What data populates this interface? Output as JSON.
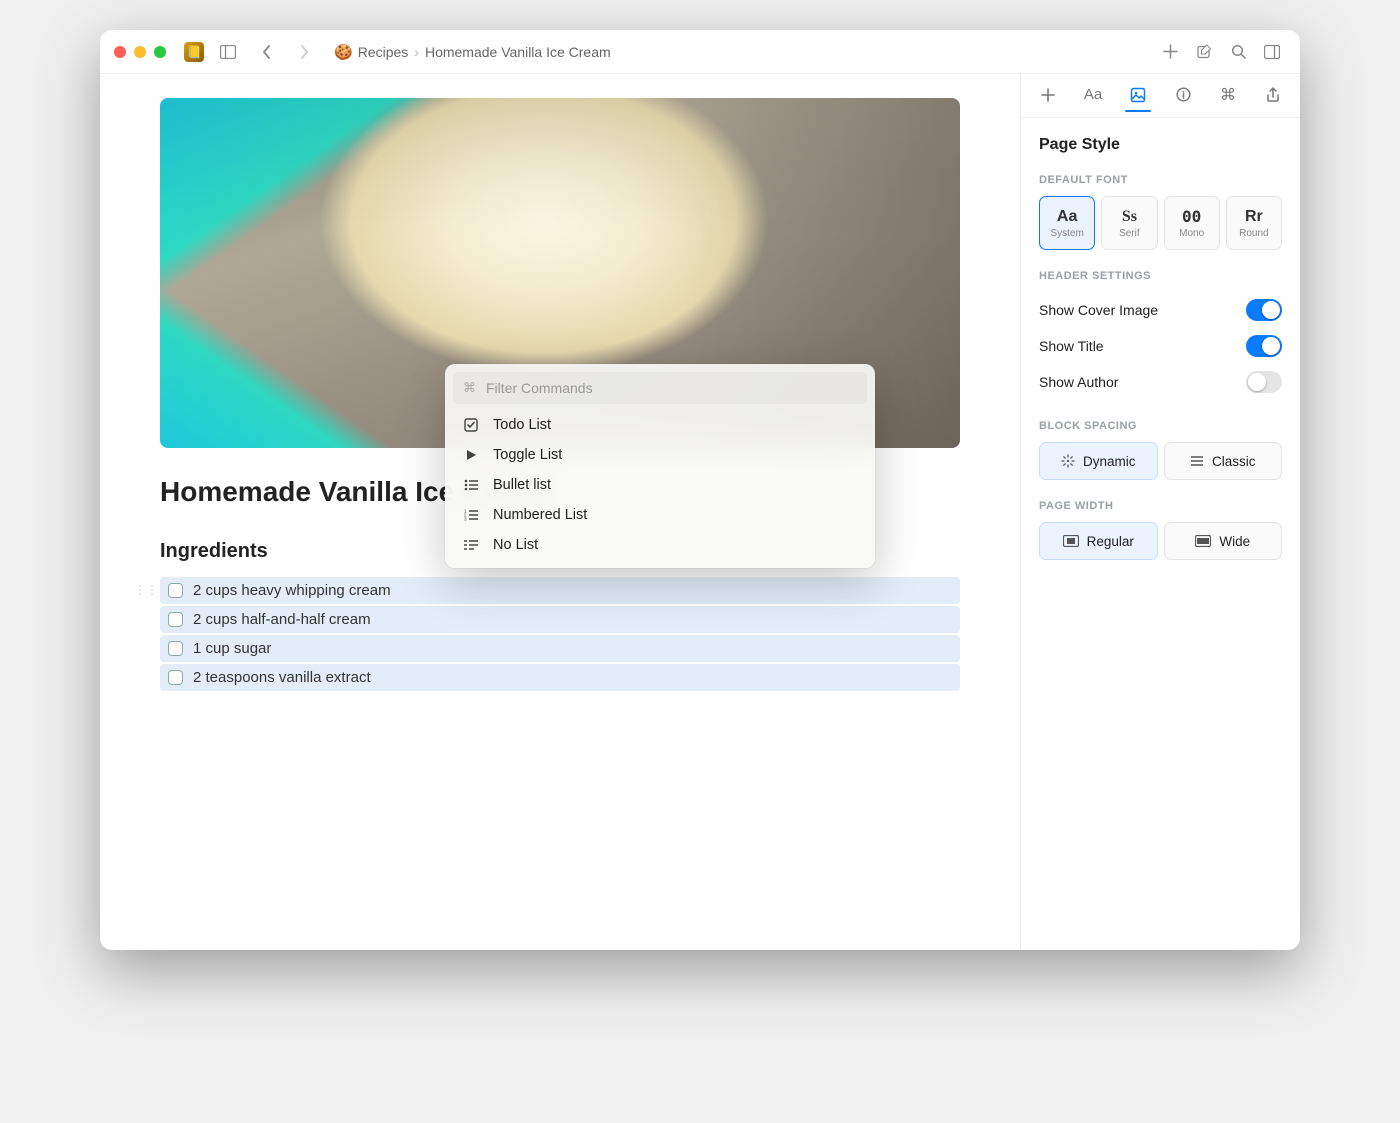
{
  "breadcrumb": {
    "parent_icon": "🍪",
    "parent_label": "Recipes",
    "current_label": "Homemade Vanilla Ice Cream"
  },
  "page": {
    "title": "Homemade Vanilla Ice Cream",
    "ingredients_heading": "Ingredients",
    "ingredients": [
      "2 cups heavy whipping cream",
      "2 cups half-and-half cream",
      "1 cup sugar",
      "2 teaspoons vanilla extract"
    ]
  },
  "command_palette": {
    "placeholder": "Filter Commands",
    "items": [
      {
        "icon": "checkbox",
        "label": "Todo List"
      },
      {
        "icon": "toggle",
        "label": "Toggle List"
      },
      {
        "icon": "bullet",
        "label": "Bullet list"
      },
      {
        "icon": "numbered",
        "label": "Numbered List"
      },
      {
        "icon": "nolist",
        "label": "No List"
      }
    ]
  },
  "sidebar_panel": {
    "title": "Page Style",
    "default_font_label": "DEFAULT FONT",
    "fonts": [
      {
        "sample": "Aa",
        "label": "System",
        "class": "system",
        "selected": true
      },
      {
        "sample": "Ss",
        "label": "Serif",
        "class": "serif",
        "selected": false
      },
      {
        "sample": "00",
        "label": "Mono",
        "class": "mono",
        "selected": false
      },
      {
        "sample": "Rr",
        "label": "Round",
        "class": "round",
        "selected": false
      }
    ],
    "header_settings_label": "HEADER SETTINGS",
    "header_toggles": [
      {
        "label": "Show Cover Image",
        "on": true
      },
      {
        "label": "Show Title",
        "on": true
      },
      {
        "label": "Show Author",
        "on": false
      }
    ],
    "block_spacing_label": "BLOCK SPACING",
    "spacing_options": [
      {
        "label": "Dynamic",
        "selected": true
      },
      {
        "label": "Classic",
        "selected": false
      }
    ],
    "page_width_label": "PAGE WIDTH",
    "width_options": [
      {
        "label": "Regular",
        "selected": true
      },
      {
        "label": "Wide",
        "selected": false
      }
    ]
  }
}
